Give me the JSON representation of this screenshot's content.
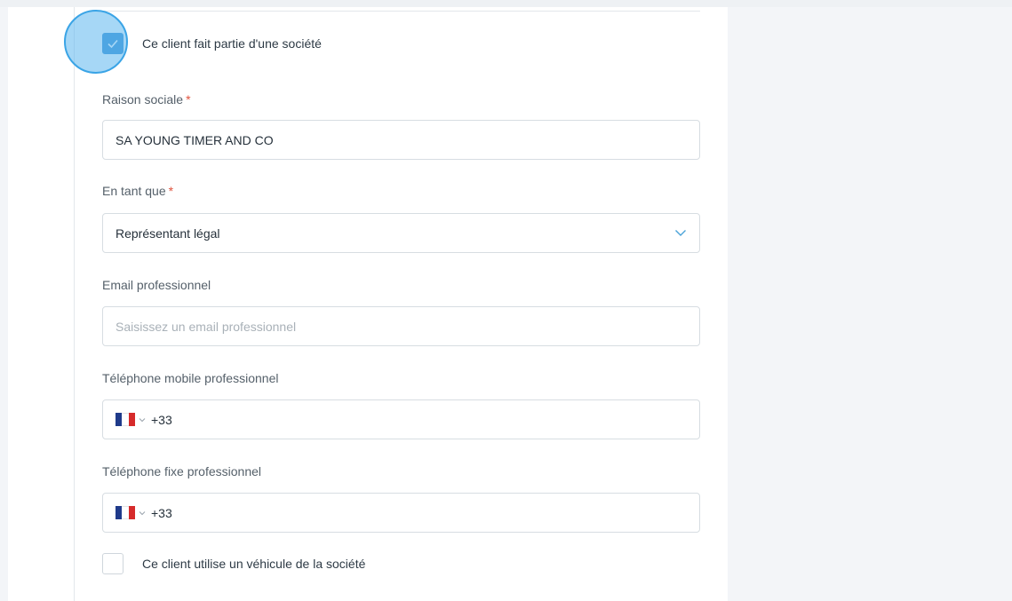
{
  "company_checkbox": {
    "label": "Ce client fait partie d'une société",
    "checked": true
  },
  "raison_sociale": {
    "label": "Raison sociale",
    "required_mark": "*",
    "value": "SA YOUNG TIMER AND CO"
  },
  "en_tant_que": {
    "label": "En tant que",
    "required_mark": "*",
    "value": "Représentant légal"
  },
  "email_pro": {
    "label": "Email professionnel",
    "placeholder": "Saisissez un email professionnel"
  },
  "mobile_pro": {
    "label": "Téléphone mobile professionnel",
    "dial_code": "+33",
    "flag": "france-flag-icon"
  },
  "fixe_pro": {
    "label": "Téléphone fixe professionnel",
    "dial_code": "+33",
    "flag": "france-flag-icon"
  },
  "vehicle_checkbox": {
    "label": "Ce client utilise un véhicule de la société",
    "checked": false
  },
  "colors": {
    "accent": "#3d93d6",
    "required": "#e0533e",
    "chevron": "#4aa3d8"
  }
}
